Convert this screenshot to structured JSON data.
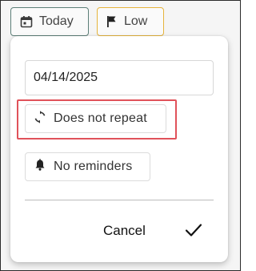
{
  "chips": {
    "date_label": "Today",
    "date_icon": "calendar-icon",
    "priority_label": "Low",
    "priority_icon": "flag-icon"
  },
  "popup": {
    "date_value": "04/14/2025",
    "repeat_label": "Does not repeat",
    "repeat_icon": "repeat-icon",
    "reminder_label": "No reminders",
    "reminder_icon": "bell-icon",
    "cancel_label": "Cancel",
    "confirm_icon": "checkmark-icon"
  },
  "colors": {
    "highlight": "#e0525a",
    "today_border": "#5d7f78",
    "low_border": "#e6b43c"
  }
}
